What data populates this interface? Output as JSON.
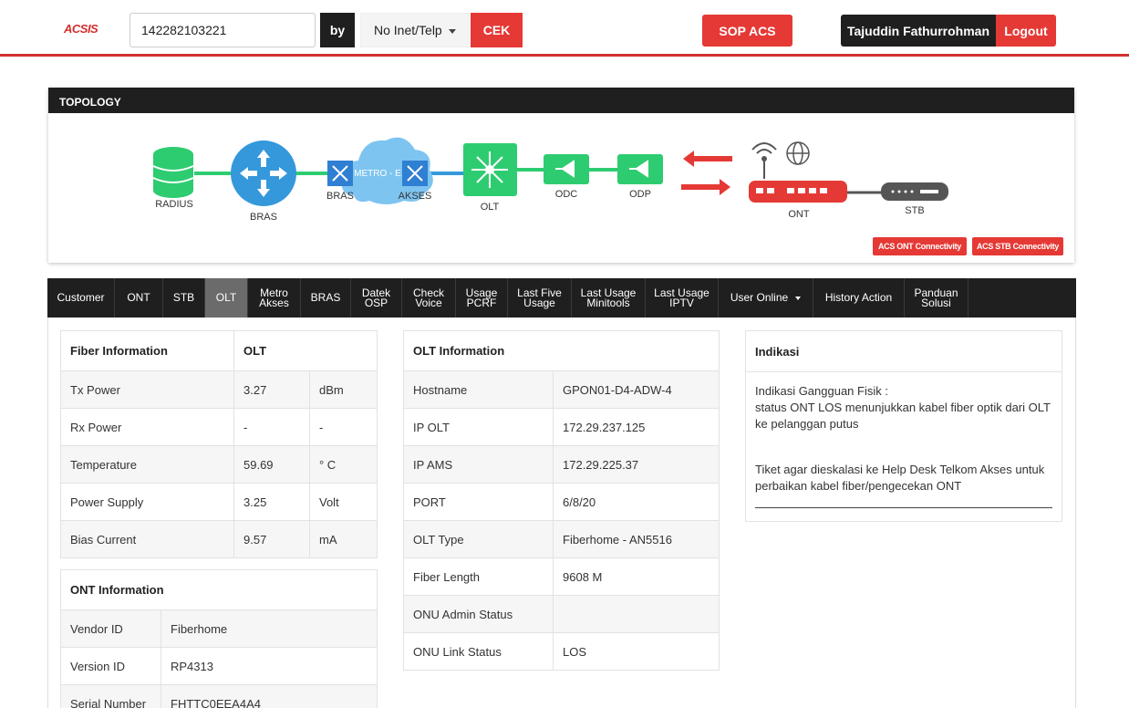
{
  "header": {
    "logo": "ACSIS",
    "search_value": "142282103221",
    "by_label": "by",
    "select_value": "No Inet/Telp",
    "cek_label": "CEK",
    "sop_label": "SOP ACS",
    "user_name": "Tajuddin Fathurrohman",
    "logout_label": "Logout"
  },
  "topology": {
    "title": "TOPOLOGY",
    "nodes": {
      "radius": "RADIUS",
      "bras": "BRAS",
      "metro": "METRO - E",
      "bras_sw": "BRAS",
      "akses_sw": "AKSES",
      "olt": "OLT",
      "odc": "ODC",
      "odp": "ODP",
      "ont": "ONT",
      "stb": "STB"
    },
    "acs_ont_btn": "ACS ONT Connectivity",
    "acs_stb_btn": "ACS STB Connectivity",
    "colors": {
      "green": "#2ecc71",
      "blue": "#3498db",
      "red": "#e53935",
      "dark": "#555555"
    }
  },
  "tabs": [
    {
      "line1": "Customer",
      "line2": ""
    },
    {
      "line1": "ONT",
      "line2": ""
    },
    {
      "line1": "STB",
      "line2": ""
    },
    {
      "line1": "OLT",
      "line2": ""
    },
    {
      "line1": "Metro",
      "line2": "Akses"
    },
    {
      "line1": "BRAS",
      "line2": ""
    },
    {
      "line1": "Datek",
      "line2": "OSP"
    },
    {
      "line1": "Check",
      "line2": "Voice"
    },
    {
      "line1": "Usage",
      "line2": "PCRF"
    },
    {
      "line1": "Last Five",
      "line2": "Usage"
    },
    {
      "line1": "Last Usage",
      "line2": "Minitools"
    },
    {
      "line1": "Last Usage",
      "line2": "IPTV"
    },
    {
      "line1": "User Online",
      "line2": ""
    },
    {
      "line1": "History Action",
      "line2": ""
    },
    {
      "line1": "Panduan",
      "line2": "Solusi"
    }
  ],
  "fiber_info": {
    "header_label": "Fiber Information",
    "header_value": "OLT",
    "rows": [
      {
        "label": "Tx Power",
        "value": "3.27",
        "unit": "dBm"
      },
      {
        "label": "Rx Power",
        "value": "-",
        "unit": "-"
      },
      {
        "label": "Temperature",
        "value": "59.69",
        "unit": "° C"
      },
      {
        "label": "Power Supply",
        "value": "3.25",
        "unit": "Volt"
      },
      {
        "label": "Bias Current",
        "value": "9.57",
        "unit": "mA"
      }
    ]
  },
  "ont_info": {
    "header_label": "ONT Information",
    "rows": [
      {
        "label": "Vendor ID",
        "value": "Fiberhome"
      },
      {
        "label": "Version ID",
        "value": "RP4313"
      },
      {
        "label": "Serial Number",
        "value": "FHTTC0EEA4A4"
      }
    ]
  },
  "olt_info": {
    "header_label": "OLT Information",
    "rows": [
      {
        "label": "Hostname",
        "value": "GPON01-D4-ADW-4"
      },
      {
        "label": "IP OLT",
        "value": "172.29.237.125"
      },
      {
        "label": "IP AMS",
        "value": "172.29.225.37"
      },
      {
        "label": "PORT",
        "value": "6/8/20"
      },
      {
        "label": "OLT Type",
        "value": "Fiberhome - AN5516"
      },
      {
        "label": "Fiber Length",
        "value": "9608 M"
      },
      {
        "label": "ONU Admin Status",
        "value": ""
      },
      {
        "label": "ONU Link Status",
        "value": "LOS"
      }
    ]
  },
  "indikasi": {
    "title": "Indikasi",
    "line1": "Indikasi Gangguan Fisik :",
    "line2": "status ONT LOS menunjukkan kabel fiber optik dari OLT ke pelanggan putus",
    "line3": "Tiket agar dieskalasi ke Help Desk Telkom Akses untuk perbaikan kabel fiber/pengecekan ONT"
  }
}
